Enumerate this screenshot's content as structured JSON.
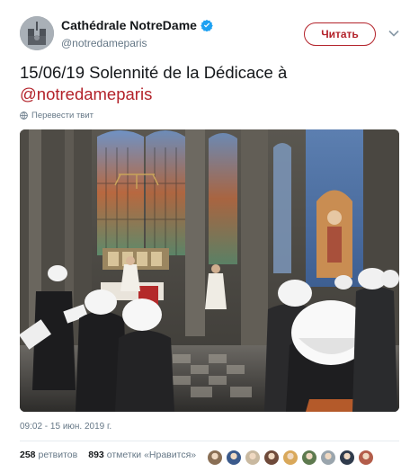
{
  "author": {
    "display_name": "Cathédrale NotreDame",
    "handle": "@notredameparis",
    "verified_icon": "verified-badge-icon"
  },
  "follow_button": {
    "label": "Читать"
  },
  "tweet": {
    "text_before": "15/06/19 Solennité de la Dédicace à ",
    "mention": "@notredameparis",
    "translate_label": "Перевести твит"
  },
  "media": {
    "alt_icon": "cathedral-mass-photo"
  },
  "meta": {
    "timestamp": "09:02 - 15 июн. 2019 г."
  },
  "stats": {
    "retweets_count": "258",
    "retweets_label": "ретвитов",
    "likes_count": "893",
    "likes_label": "отметки «Нравится»"
  },
  "colors": {
    "accent": "#b3222a",
    "verified": "#1da1f2",
    "muted": "#657786"
  },
  "likers": [
    {
      "color": "#8a6f55"
    },
    {
      "color": "#3b5a8c"
    },
    {
      "color": "#c9b9a0"
    },
    {
      "color": "#6f4a3a"
    },
    {
      "color": "#d9a85a"
    },
    {
      "color": "#5e7a4f"
    },
    {
      "color": "#9aa5ad"
    },
    {
      "color": "#2f3b4c"
    },
    {
      "color": "#b35d4a"
    }
  ]
}
